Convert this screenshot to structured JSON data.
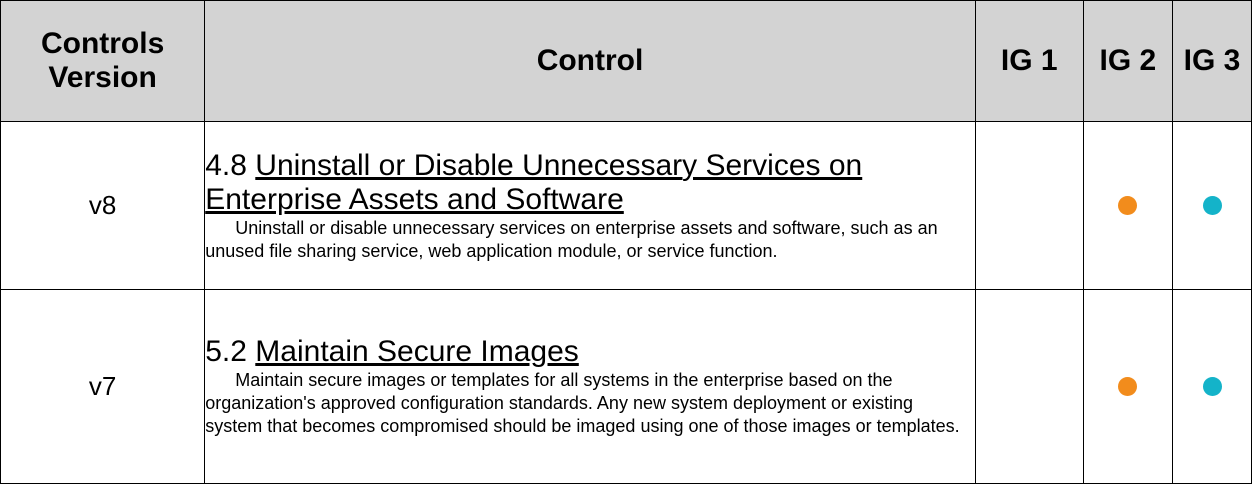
{
  "header": {
    "version": "Controls Version",
    "control": "Control",
    "ig1": "IG 1",
    "ig2": "IG 2",
    "ig3": "IG 3"
  },
  "colors": {
    "header_bg": "#d3d3d3",
    "ig2_dot": "#f28c1c",
    "ig3_dot": "#14b3c9"
  },
  "rows": [
    {
      "version": "v8",
      "number": "4.8",
      "title": "Uninstall or Disable Unnecessary Services on Enterprise Assets and Software",
      "description": "Uninstall or disable unnecessary services on enterprise assets and software, such as an unused file sharing service, web application module, or service function.",
      "ig1": false,
      "ig2": true,
      "ig3": true
    },
    {
      "version": "v7",
      "number": "5.2",
      "title": "Maintain Secure Images",
      "description": "Maintain secure images or templates for all systems in the enterprise based on the organization's approved configuration standards. Any new system deployment or existing system that becomes compromised should be imaged using one of those images or templates.",
      "ig1": false,
      "ig2": true,
      "ig3": true
    }
  ]
}
